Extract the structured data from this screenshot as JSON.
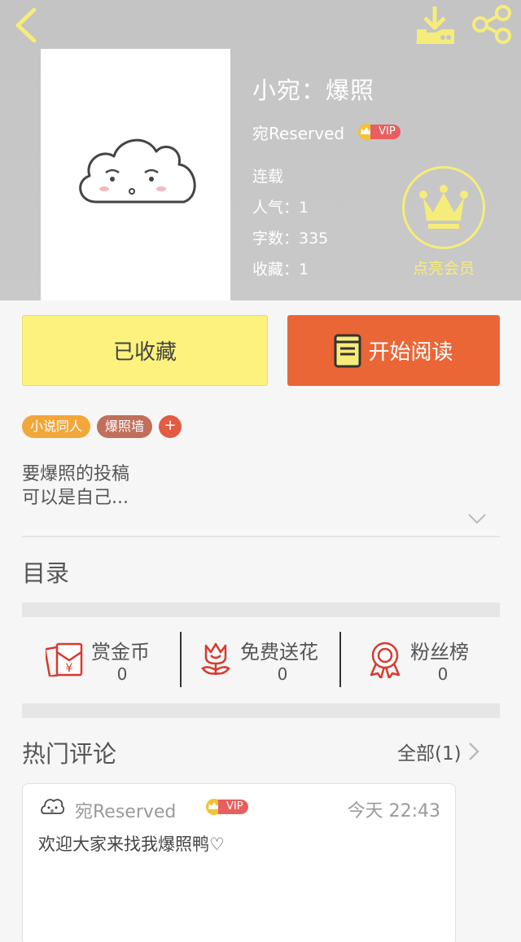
{
  "header": {
    "title": "小宛：爆照",
    "author": "宛Reserved",
    "vip_label": "VIP",
    "status": "连载",
    "popularity": "人气：1",
    "word_count": "字数：335",
    "favorites": "收藏：1",
    "member_label": "点亮会员",
    "icons": [
      "back-icon",
      "download-icon",
      "share-icon",
      "crown-icon"
    ]
  },
  "actions": {
    "collect_label": "已收藏",
    "read_label": "开始阅读"
  },
  "tags": [
    "小说同人",
    "爆照墙"
  ],
  "tag_add": "+",
  "description": {
    "line1": "要爆照的投稿",
    "line2": "可以是自己..."
  },
  "catalog_label": "目录",
  "stats_bar": [
    {
      "label": "赏金币",
      "count": "0",
      "icon": "red-envelope-icon"
    },
    {
      "label": "免费送花",
      "count": "0",
      "icon": "flower-icon"
    },
    {
      "label": "粉丝榜",
      "count": "0",
      "icon": "medal-icon"
    }
  ],
  "comments_section": {
    "title": "热门评论",
    "all_link": "全部(1)",
    "items": [
      {
        "user": "宛Reserved",
        "vip": "VIP",
        "time": "今天 22:43",
        "text": "欢迎大家来找我爆照鸭♡"
      }
    ]
  },
  "colors": {
    "header_bg": "#c6c6c6",
    "collect_bg": "#fcf27d",
    "read_bg": "#ea6637",
    "member_yellow": "#f6ec7a",
    "icon_red": "#d83a2e"
  }
}
